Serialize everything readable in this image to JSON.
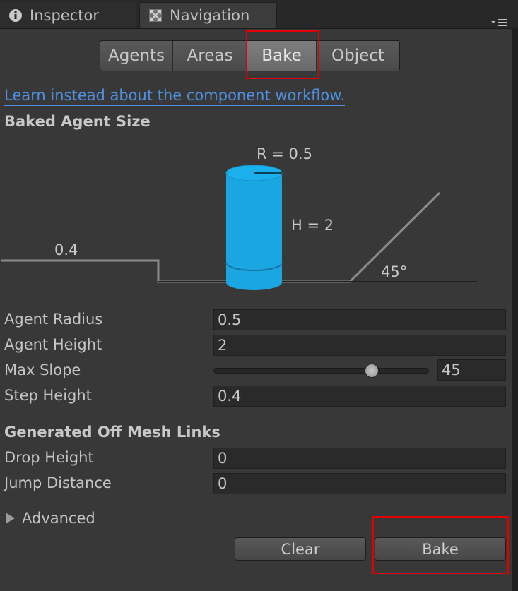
{
  "tabs": {
    "inspector_label": "Inspector",
    "navigation_label": "Navigation"
  },
  "segments": {
    "agents": "Agents",
    "areas": "Areas",
    "bake": "Bake",
    "object": "Object",
    "selected": "Bake"
  },
  "link_text": "Learn instead about the component workflow.",
  "baked_agent_size": {
    "title": "Baked Agent Size",
    "radius_label": "R = 0.5",
    "height_label": "H = 2",
    "step_label": "0.4",
    "slope_label": "45°"
  },
  "properties": {
    "agent_radius": {
      "label": "Agent Radius",
      "value": "0.5"
    },
    "agent_height": {
      "label": "Agent Height",
      "value": "2"
    },
    "max_slope": {
      "label": "Max Slope",
      "value": "45",
      "slider_fraction": 0.75
    },
    "step_height": {
      "label": "Step Height",
      "value": "0.4"
    }
  },
  "off_mesh": {
    "title": "Generated Off Mesh Links",
    "drop_height": {
      "label": "Drop Height",
      "value": "0"
    },
    "jump_distance": {
      "label": "Jump Distance",
      "value": "0"
    }
  },
  "advanced_label": "Advanced",
  "buttons": {
    "clear": "Clear",
    "bake": "Bake"
  },
  "colors": {
    "background": "#383838",
    "link": "#4f8fdf",
    "agent_cylinder": "#1aa6e0",
    "highlight": "#e00000"
  },
  "icons": {
    "inspector": "info-icon",
    "navigation": "navigation-icon",
    "menu": "tab-menu-icon",
    "foldout": "triangle-right-icon"
  }
}
